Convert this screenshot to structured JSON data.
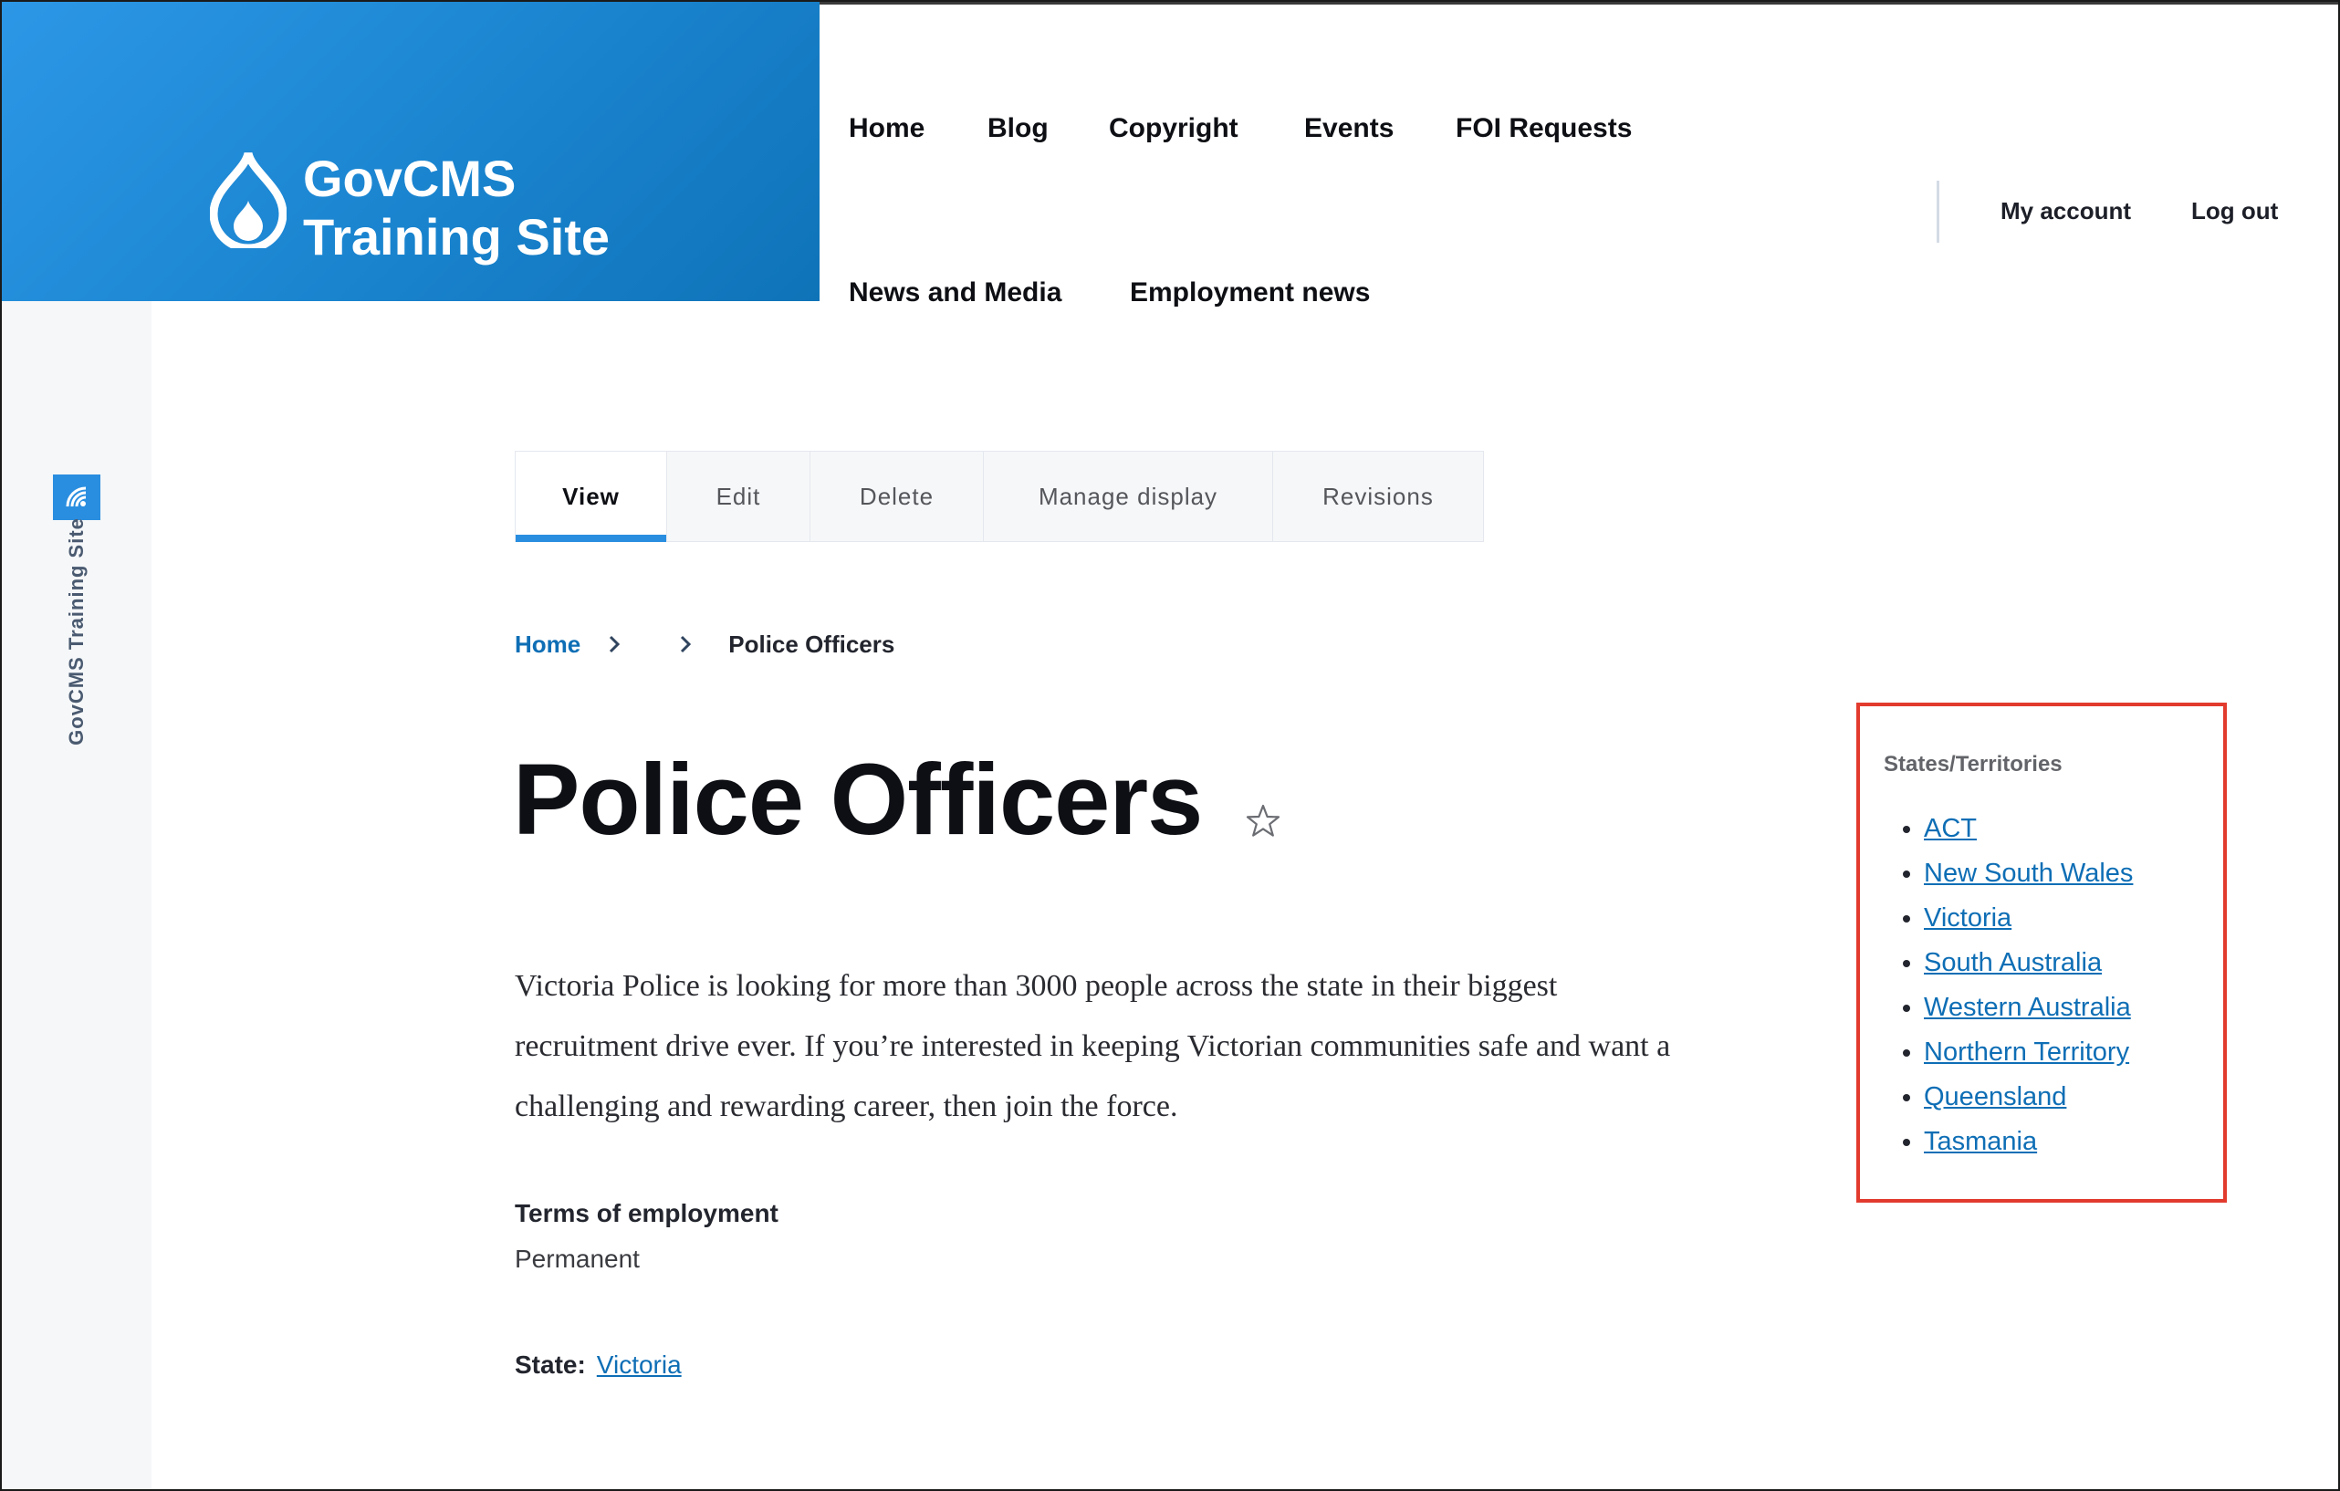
{
  "site": {
    "name_line1": "GovCMS",
    "name_line2": "Training Site",
    "toolbar_label": "GovCMS Training Site"
  },
  "colors": {
    "brand_blue": "#1a84cf",
    "accent_blue": "#2a8ee0",
    "link": "#0e6eb5",
    "highlight_border": "#e23b2e"
  },
  "main_nav": {
    "items": [
      "Home",
      "Blog",
      "Copyright",
      "Events",
      "FOI Requests",
      "News and Media",
      "Employment news"
    ]
  },
  "secondary_nav": {
    "my_account": "My account",
    "log_out": "Log out"
  },
  "tabs": {
    "items": [
      "View",
      "Edit",
      "Delete",
      "Manage display",
      "Revisions"
    ],
    "active": "View"
  },
  "breadcrumb": {
    "home": "Home",
    "current": "Police Officers"
  },
  "page": {
    "title": "Police Officers",
    "body": "Victoria Police is looking for more than 3000 people across the state in their biggest recruitment drive ever. If you’re interested in keeping Victorian communities safe and want a challenging and rewarding career, then join the force.",
    "terms_label": "Terms of employment",
    "terms_value": "Permanent",
    "state_label": "State:",
    "state_value": "Victoria"
  },
  "states_block": {
    "title": "States/Territories",
    "items": [
      "ACT",
      "New South Wales",
      "Victoria",
      "South Australia",
      "Western Australia",
      "Northern Territory",
      "Queensland",
      "Tasmania"
    ]
  },
  "icons": {
    "toolbar": "drupal-toolbar-icon",
    "logo": "drupal-drop-logo",
    "breadcrumb_separator": "chevron-right-icon",
    "favorite": "star-outline-icon"
  }
}
